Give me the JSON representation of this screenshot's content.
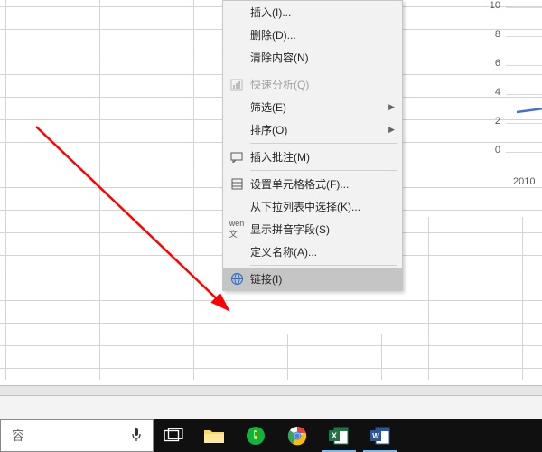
{
  "menu": {
    "insert": "插入(I)...",
    "delete": "删除(D)...",
    "clear": "清除内容(N)",
    "quick_analysis": "快速分析(Q)",
    "filter": "筛选(E)",
    "sort": "排序(O)",
    "insert_comment": "插入批注(M)",
    "format_cells": "设置单元格格式(F)...",
    "pick_list": "从下拉列表中选择(K)...",
    "phonetic": "显示拼音字段(S)",
    "define_name": "定义名称(A)...",
    "link": "链接(I)"
  },
  "chart_data": {
    "type": "line",
    "y_ticks": [
      0,
      2,
      4,
      6,
      8,
      10
    ],
    "x_ticks": [
      "2010"
    ],
    "series": [
      {
        "name": "",
        "values": [
          2.9,
          3.1
        ]
      }
    ]
  },
  "taskbar": {
    "search_label": "容",
    "apps": [
      "taskview",
      "explorer",
      "music",
      "chrome",
      "excel",
      "word"
    ]
  },
  "colors": {
    "excel": "#217346",
    "word": "#2b579a",
    "arrow": "#ff0000"
  }
}
